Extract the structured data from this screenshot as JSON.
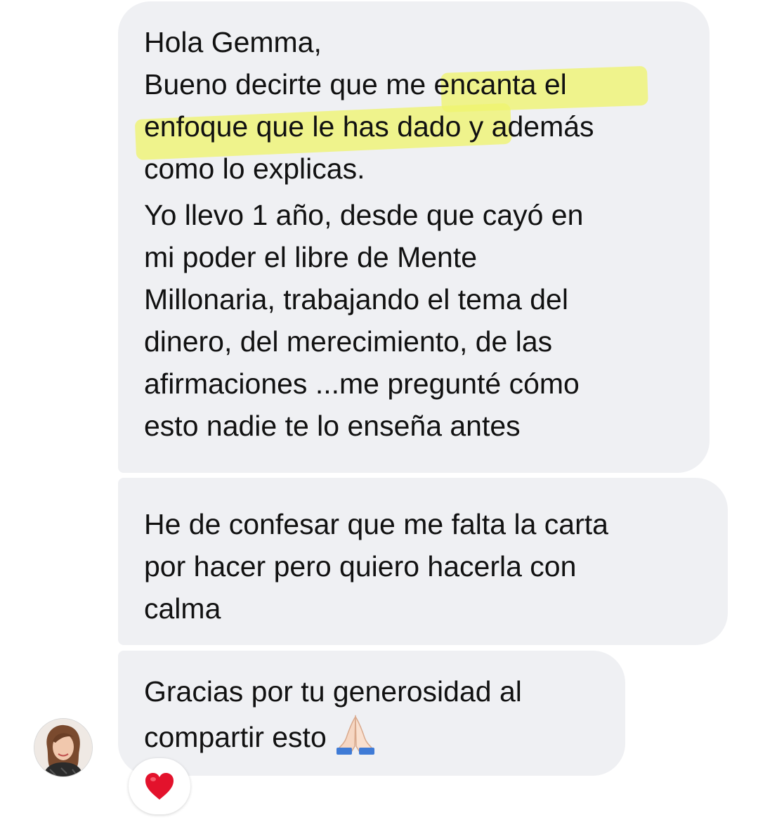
{
  "messages": [
    {
      "paragraphs": [
        "Hola Gemma,\nBueno decirte que me encanta el\nenfoque que le has dado y además\ncomo lo explicas.",
        "Yo llevo 1 año, desde que cayó en\nmi poder el libre de Mente\nMillonaria, trabajando el tema del\ndinero, del merecimiento, de las\nafirmaciones ...me pregunté cómo\nesto nadie te lo enseña antes"
      ]
    },
    {
      "text": "He de confesar que me falta la carta\npor hacer pero quiero hacerla con\ncalma"
    },
    {
      "text": "Gracias por tu generosidad al\ncompartir esto",
      "emoji": "folded-hands-icon"
    }
  ],
  "reaction": {
    "emoji": "heart-icon"
  },
  "sender": {
    "avatar": "avatar-photo"
  },
  "colors": {
    "bubble": "#eff0f3",
    "highlight": "#eef36e",
    "heart": "#e3122c"
  }
}
